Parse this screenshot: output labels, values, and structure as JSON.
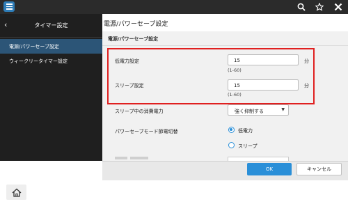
{
  "header": {
    "menu_icon": "menu-icon",
    "icons": [
      "search-icon",
      "star-icon",
      "tools-icon"
    ]
  },
  "sidebar": {
    "back_icon": "chevron-left-icon",
    "back_glyph": "‹",
    "title": "タイマー設定",
    "items": [
      {
        "label": "電源/パワーセーブ設定",
        "active": true
      },
      {
        "label": "ウィークリータイマー設定",
        "active": false
      }
    ]
  },
  "main": {
    "title": "電源/パワーセーブ設定",
    "section_title": "電源/パワーセーブ設定",
    "fields": {
      "low_power": {
        "label": "低電力設定",
        "value": "15",
        "unit": "分",
        "range": "(1-60)"
      },
      "sleep": {
        "label": "スリープ設定",
        "value": "15",
        "unit": "分",
        "range": "(1-60)"
      }
    },
    "sleep_power": {
      "label": "スリープ中の消費電力",
      "selected": "強く抑制する",
      "arrow": "▼"
    },
    "power_save_mode": {
      "label": "パワーセーブモード節電切替",
      "options": [
        {
          "label": "低電力",
          "checked": true
        },
        {
          "label": "スリープ",
          "checked": false
        }
      ]
    }
  },
  "footer": {
    "ok_label": "OK",
    "cancel_label": "キャンセル"
  },
  "bottom": {
    "home_icon": "home-icon"
  },
  "colors": {
    "accent": "#2a8fd8",
    "highlight": "#e02020",
    "sidebar_active": "#2c5577",
    "topbar": "#2b2b2b"
  }
}
